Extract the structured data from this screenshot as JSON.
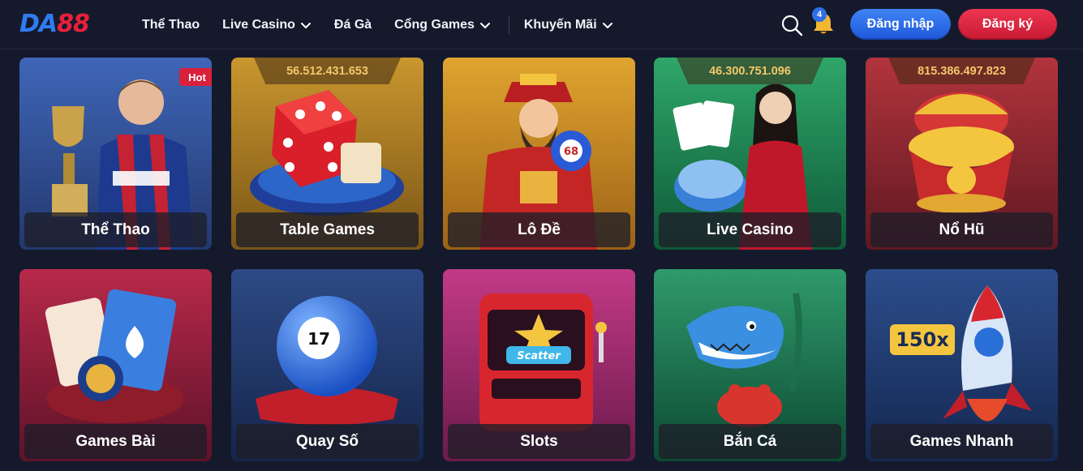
{
  "logo": {
    "part1": "DA",
    "part2": "88"
  },
  "nav": [
    {
      "label": "Thể Thao",
      "dropdown": false
    },
    {
      "label": "Live Casino",
      "dropdown": true
    },
    {
      "label": "Đá Gà",
      "dropdown": false
    },
    {
      "label": "Cổng Games",
      "dropdown": true
    },
    {
      "label": "Khuyến Mãi",
      "dropdown": true
    }
  ],
  "header": {
    "notification_count": "4",
    "login_label": "Đăng nhập",
    "register_label": "Đăng ký",
    "search_icon": "search-icon",
    "bell_icon": "bell-icon"
  },
  "colors": {
    "background": "#141a2c",
    "brand_blue": "#2f7bf0",
    "brand_red": "#e8203a",
    "jackpot_gold": "#f3c76b"
  },
  "cards": [
    {
      "label": "Thể Thao",
      "badge": "Hot",
      "jackpot": "",
      "theme": "sports"
    },
    {
      "label": "Table Games",
      "badge": "",
      "jackpot": "56.512.431.653",
      "theme": "dice"
    },
    {
      "label": "Lô Đề",
      "badge": "",
      "jackpot": "",
      "theme": "lottery-god",
      "ball_number": "68"
    },
    {
      "label": "Live Casino",
      "badge": "",
      "jackpot": "46.300.751.096",
      "theme": "dealer"
    },
    {
      "label": "Nổ Hũ",
      "badge": "",
      "jackpot": "815.386.497.823",
      "theme": "treasure-pot"
    },
    {
      "label": "Games Bài",
      "badge": "",
      "jackpot": "",
      "theme": "cards"
    },
    {
      "label": "Quay Số",
      "badge": "",
      "jackpot": "",
      "theme": "lotto-ball",
      "ball_number": "17"
    },
    {
      "label": "Slots",
      "badge": "",
      "jackpot": "",
      "theme": "slot-machine",
      "sign_text": "Scatter"
    },
    {
      "label": "Bắn Cá",
      "badge": "",
      "jackpot": "",
      "theme": "fish"
    },
    {
      "label": "Games Nhanh",
      "badge": "",
      "jackpot": "",
      "theme": "rocket",
      "multiplier_text": "150x"
    }
  ]
}
